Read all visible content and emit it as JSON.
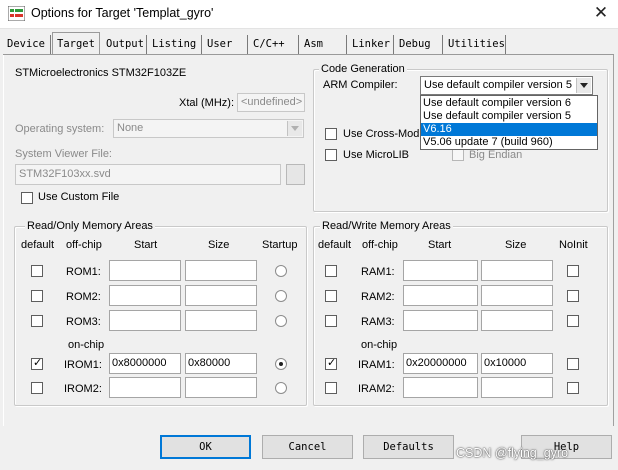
{
  "window": {
    "title": "Options for Target 'Templat_gyro'",
    "close_glyph": "✕"
  },
  "tabs": [
    {
      "label": "Device"
    },
    {
      "label": "Target",
      "active": true
    },
    {
      "label": "Output"
    },
    {
      "label": "Listing"
    },
    {
      "label": "User"
    },
    {
      "label": "C/C++"
    },
    {
      "label": "Asm"
    },
    {
      "label": "Linker"
    },
    {
      "label": "Debug"
    },
    {
      "label": "Utilities"
    }
  ],
  "device": {
    "name": "STMicroelectronics STM32F103ZE",
    "xtal_label": "Xtal (MHz):",
    "xtal_value": "<undefined>",
    "os_label": "Operating system:",
    "os_value": "None",
    "svd_label": "System Viewer File:",
    "svd_value": "STM32F103xx.svd",
    "custom_file_label": "Use Custom File"
  },
  "codegen": {
    "group_title": "Code Generation",
    "compiler_label": "ARM Compiler:",
    "compiler_value": "Use default compiler version 5",
    "options": [
      "Use default compiler version 6",
      "Use default compiler version 5",
      "V6.16",
      "V5.06 update 7 (build 960)"
    ],
    "highlighted_option": "V6.16",
    "cross_module_label": "Use Cross-Modu",
    "microlib_label": "Use MicroLIB",
    "big_endian_label": "Big Endian"
  },
  "ro_memory": {
    "group_title": "Read/Only Memory Areas",
    "headers": {
      "default": "default",
      "offchip": "off-chip",
      "start": "Start",
      "size": "Size",
      "startup": "Startup"
    },
    "onchip_label": "on-chip",
    "rows": [
      {
        "name": "ROM1:",
        "start": "",
        "size": "",
        "default": false,
        "startup": false
      },
      {
        "name": "ROM2:",
        "start": "",
        "size": "",
        "default": false,
        "startup": false
      },
      {
        "name": "ROM3:",
        "start": "",
        "size": "",
        "default": false,
        "startup": false
      },
      {
        "name": "IROM1:",
        "start": "0x8000000",
        "size": "0x80000",
        "default": true,
        "startup": true
      },
      {
        "name": "IROM2:",
        "start": "",
        "size": "",
        "default": false,
        "startup": false
      }
    ]
  },
  "rw_memory": {
    "group_title": "Read/Write Memory Areas",
    "headers": {
      "default": "default",
      "offchip": "off-chip",
      "start": "Start",
      "size": "Size",
      "noinit": "NoInit"
    },
    "onchip_label": "on-chip",
    "rows": [
      {
        "name": "RAM1:",
        "start": "",
        "size": "",
        "default": false,
        "noinit": false
      },
      {
        "name": "RAM2:",
        "start": "",
        "size": "",
        "default": false,
        "noinit": false
      },
      {
        "name": "RAM3:",
        "start": "",
        "size": "",
        "default": false,
        "noinit": false
      },
      {
        "name": "IRAM1:",
        "start": "0x20000000",
        "size": "0x10000",
        "default": true,
        "noinit": false
      },
      {
        "name": "IRAM2:",
        "start": "",
        "size": "",
        "default": false,
        "noinit": false
      }
    ]
  },
  "buttons": {
    "ok": "OK",
    "cancel": "Cancel",
    "defaults": "Defaults",
    "help": "Help"
  },
  "watermark": "CSDN @flying_gyro",
  "colors": {
    "highlight": "#0078d7",
    "app_icon_green": "#2e9a3a",
    "app_icon_red": "#d9342b"
  },
  "icons": {
    "app": "keil-options-icon",
    "close": "close-icon",
    "checkmark": "check-icon"
  }
}
